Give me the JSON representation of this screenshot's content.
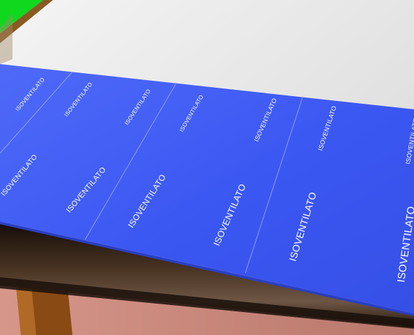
{
  "scene": {
    "panel_text": "ISOVENTILATO",
    "colors": {
      "panel": "#3d5cf5",
      "panel_edge": "#2d46d8",
      "wall": "#dcdcdc",
      "green_sign": "#0fd81f",
      "wood": "#9a5a1a",
      "beam_dark": "#2a1b10",
      "floor": "#c8857a"
    }
  }
}
